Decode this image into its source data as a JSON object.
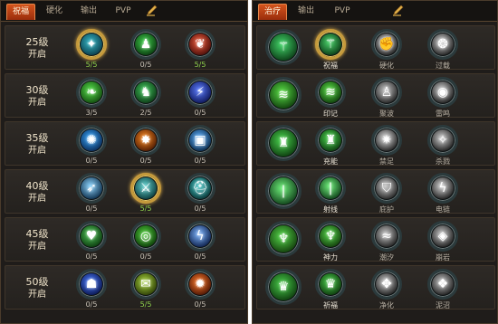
{
  "left_panel": {
    "tabs": [
      {
        "label": "祝福",
        "active": true
      },
      {
        "label": "硬化",
        "active": false
      },
      {
        "label": "输出",
        "active": false
      },
      {
        "label": "PVP",
        "active": false
      }
    ],
    "rows": [
      {
        "level": "25级",
        "status": "开启",
        "skills": [
          {
            "icon": "rune-circle-icon",
            "count": "5/5",
            "full": true,
            "selected": true
          },
          {
            "icon": "green-figure-icon",
            "count": "0/5",
            "full": false,
            "selected": false
          },
          {
            "icon": "red-feather-icon",
            "count": "5/5",
            "full": true,
            "selected": false
          }
        ]
      },
      {
        "level": "30级",
        "status": "开启",
        "skills": [
          {
            "icon": "green-leaf-icon",
            "count": "3/5",
            "full": false,
            "selected": false
          },
          {
            "icon": "green-warrior-icon",
            "count": "2/5",
            "full": false,
            "selected": false
          },
          {
            "icon": "blue-slash-icon",
            "count": "0/5",
            "full": false,
            "selected": false
          }
        ]
      },
      {
        "level": "35级",
        "status": "开启",
        "skills": [
          {
            "icon": "blue-burst-icon",
            "count": "0/5",
            "full": false,
            "selected": false
          },
          {
            "icon": "fire-burst-icon",
            "count": "0/5",
            "full": false,
            "selected": false
          },
          {
            "icon": "blue-chest-icon",
            "count": "0/5",
            "full": false,
            "selected": false
          }
        ]
      },
      {
        "level": "40级",
        "status": "开启",
        "skills": [
          {
            "icon": "ice-spike-icon",
            "count": "0/5",
            "full": false,
            "selected": false
          },
          {
            "icon": "blue-blade-icon",
            "count": "5/5",
            "full": true,
            "selected": true
          },
          {
            "icon": "teal-helmet-icon",
            "count": "0/5",
            "full": false,
            "selected": false
          }
        ]
      },
      {
        "level": "45级",
        "status": "开启",
        "skills": [
          {
            "icon": "heart-icon",
            "count": "0/5",
            "full": false,
            "selected": false
          },
          {
            "icon": "green-target-icon",
            "count": "0/5",
            "full": false,
            "selected": false
          },
          {
            "icon": "lightning-icon",
            "count": "0/5",
            "full": false,
            "selected": false
          }
        ]
      },
      {
        "level": "50级",
        "status": "开启",
        "skills": [
          {
            "icon": "blue-mask-icon",
            "count": "0/5",
            "full": false,
            "selected": false
          },
          {
            "icon": "green-scroll-icon",
            "count": "5/5",
            "full": true,
            "selected": false
          },
          {
            "icon": "flame-icon",
            "count": "0/5",
            "full": false,
            "selected": false
          }
        ]
      }
    ]
  },
  "right_panel": {
    "tabs": [
      {
        "label": "治疗",
        "active": true
      },
      {
        "label": "输出",
        "active": false
      },
      {
        "label": "PVP",
        "active": false
      }
    ],
    "rows": [
      {
        "base_icon": "green-staff-icon",
        "skills": [
          {
            "icon": "staff-bless-icon",
            "label": "祝福",
            "active": true,
            "selected": true
          },
          {
            "icon": "gray-fist-icon",
            "label": "硬化",
            "active": false,
            "selected": false
          },
          {
            "icon": "gray-orb-icon",
            "label": "过载",
            "active": false,
            "selected": false
          }
        ]
      },
      {
        "base_icon": "green-claw-icon",
        "skills": [
          {
            "icon": "green-claw-mark-icon",
            "label": "印记",
            "active": true,
            "selected": false
          },
          {
            "icon": "gray-figure-icon",
            "label": "聚波",
            "active": false,
            "selected": false
          },
          {
            "icon": "gray-ring-icon",
            "label": "雷鸣",
            "active": false,
            "selected": false
          }
        ]
      },
      {
        "base_icon": "green-giant-icon",
        "skills": [
          {
            "icon": "green-giant-small-icon",
            "label": "充能",
            "active": true,
            "selected": false
          },
          {
            "icon": "gray-star-icon",
            "label": "禁足",
            "active": false,
            "selected": false
          },
          {
            "icon": "gray-crystal-icon",
            "label": "杀戮",
            "active": false,
            "selected": false
          }
        ]
      },
      {
        "base_icon": "green-beam-icon",
        "skills": [
          {
            "icon": "green-beam-small-icon",
            "label": "射线",
            "active": true,
            "selected": false
          },
          {
            "icon": "gray-shield-icon",
            "label": "庇护",
            "active": false,
            "selected": false
          },
          {
            "icon": "gray-chain-icon",
            "label": "电链",
            "active": false,
            "selected": false
          }
        ]
      },
      {
        "base_icon": "green-totem-icon",
        "skills": [
          {
            "icon": "green-totem-small-icon",
            "label": "神力",
            "active": true,
            "selected": false
          },
          {
            "icon": "gray-wave-icon",
            "label": "潮汐",
            "active": false,
            "selected": false
          },
          {
            "icon": "gray-stone-icon",
            "label": "崩岩",
            "active": false,
            "selected": false
          }
        ]
      },
      {
        "base_icon": "green-idol-icon",
        "skills": [
          {
            "icon": "green-idol-small-icon",
            "label": "祈福",
            "active": true,
            "selected": false
          },
          {
            "icon": "gray-purify-icon",
            "label": "净化",
            "active": false,
            "selected": false
          },
          {
            "icon": "gray-mud-icon",
            "label": "泥沼",
            "active": false,
            "selected": false
          }
        ]
      }
    ]
  },
  "colors": {
    "accent_tab": "#c7481a",
    "count_full": "#8fd14c",
    "count_normal": "#c7bfb3",
    "selected_ring": "#c59a3c"
  }
}
